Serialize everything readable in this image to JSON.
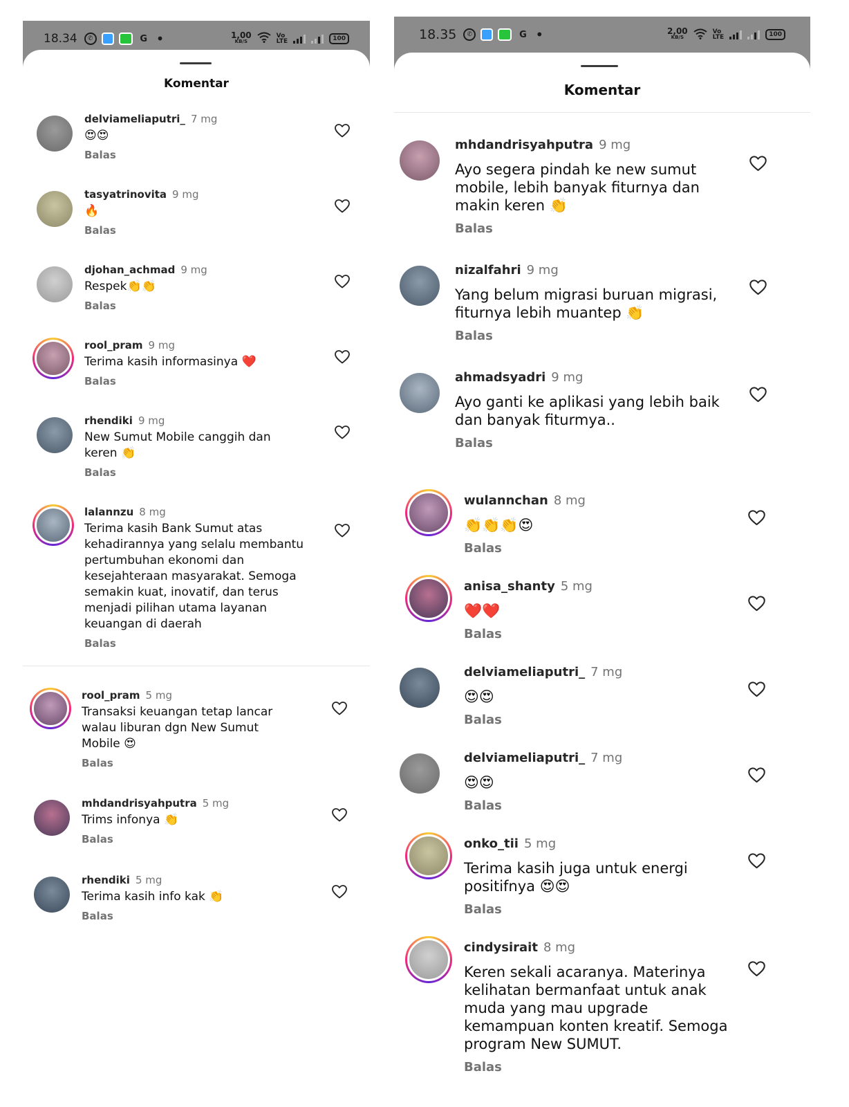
{
  "left": {
    "status": {
      "time": "18.34",
      "speed_value": "1,00",
      "speed_unit": "KB/S",
      "battery": "100"
    },
    "title": "Komentar",
    "comments": [
      {
        "user": "delviameliaputri_",
        "time": "7 mg",
        "text": "😍😍",
        "reply": "Balas"
      },
      {
        "user": "tasyatrinovita",
        "time": "9 mg",
        "text": "🔥",
        "reply": "Balas"
      },
      {
        "user": "djohan_achmad",
        "time": "9 mg",
        "text": "Respek👏👏",
        "reply": "Balas"
      },
      {
        "user": "rool_pram",
        "time": "9 mg",
        "text": "Terima kasih informasinya ❤️",
        "reply": "Balas"
      },
      {
        "user": "rhendiki",
        "time": "9 mg",
        "text": "New Sumut Mobile canggih dan\nkeren 👏",
        "reply": "Balas"
      },
      {
        "user": "lalannzu",
        "time": "8 mg",
        "text": "Terima kasih Bank Sumut atas\nkehadirannya yang selalu membantu\npertumbuhan ekonomi dan\nkesejahteraan masyarakat. Semoga\nsemakin kuat, inovatif, dan terus\nmenjadi pilihan utama layanan\nkeuangan di daerah",
        "reply": "Balas"
      },
      {
        "user": "rool_pram",
        "time": "5 mg",
        "text": "Transaksi keuangan tetap lancar\nwalau liburan dgn New Sumut\nMobile 😍",
        "reply": "Balas"
      },
      {
        "user": "mhdandrisyahputra",
        "time": "5 mg",
        "text": "Trims infonya 👏",
        "reply": "Balas"
      },
      {
        "user": "rhendiki",
        "time": "5 mg",
        "text": "Terima kasih info kak 👏",
        "reply": "Balas"
      }
    ]
  },
  "right": {
    "status": {
      "time": "18.35",
      "speed_value": "2,00",
      "speed_unit": "KB/S",
      "battery": "100"
    },
    "title": "Komentar",
    "comments": [
      {
        "user": "mhdandrisyahputra",
        "time": "9 mg",
        "text": "Ayo segera pindah ke new sumut\nmobile, lebih banyak fiturnya dan\nmakin keren 👏",
        "reply": "Balas"
      },
      {
        "user": "nizalfahri",
        "time": "9 mg",
        "text": "Yang belum migrasi buruan migrasi,\nfiturnya lebih muantep 👏",
        "reply": "Balas"
      },
      {
        "user": "ahmadsyadri",
        "time": "9 mg",
        "text": "Ayo ganti ke aplikasi yang lebih baik\ndan banyak fiturmya..",
        "reply": "Balas"
      },
      {
        "user": "wulannchan",
        "time": "8 mg",
        "text": "👏👏👏😍",
        "reply": "Balas"
      },
      {
        "user": "anisa_shanty",
        "time": "5 mg",
        "text": "❤️❤️",
        "reply": "Balas"
      },
      {
        "user": "delviameliaputri_",
        "time": "7 mg",
        "text": "😍😍",
        "reply": "Balas"
      },
      {
        "user": "delviameliaputri_",
        "time": "7 mg",
        "text": "😍😍",
        "reply": "Balas"
      },
      {
        "user": "onko_tii",
        "time": "5 mg",
        "text": "Terima kasih juga untuk energi\npositifnya 😍😍",
        "reply": "Balas"
      },
      {
        "user": "cindysirait",
        "time": "8 mg",
        "text": "Keren sekali acaranya. Materinya\nkelihatan bermanfaat untuk anak\nmuda yang mau upgrade\nkemampuan konten kreatif. Semoga\nprogram New SUMUT.",
        "reply": "Balas"
      }
    ]
  }
}
